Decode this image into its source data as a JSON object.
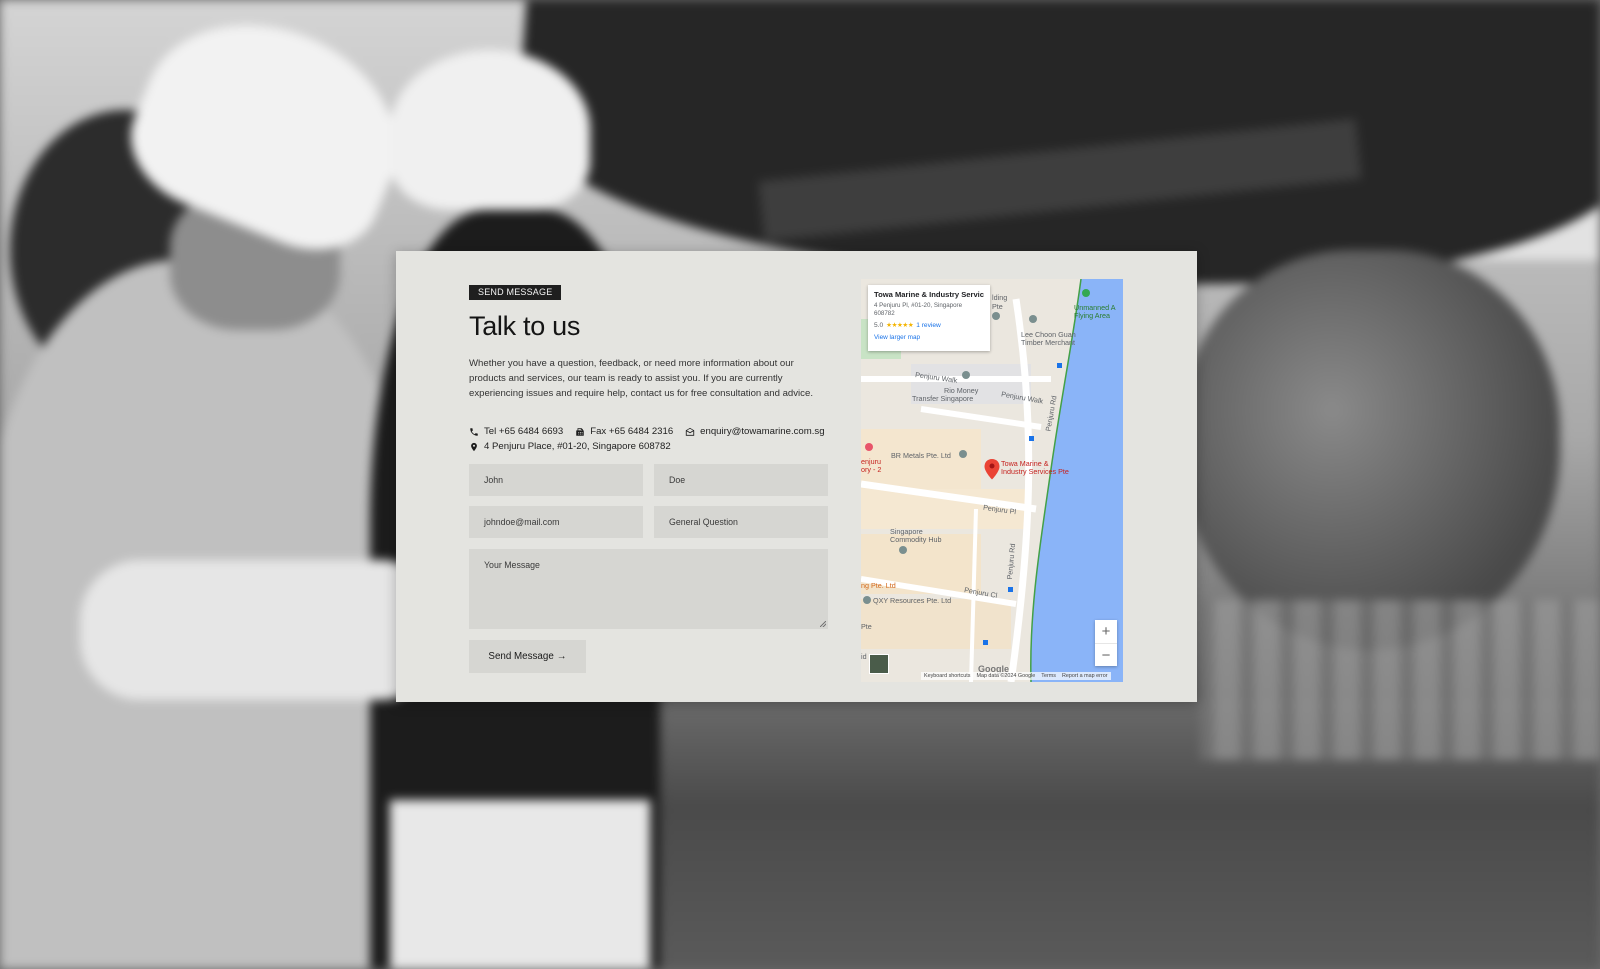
{
  "section": {
    "badge": "SEND MESSAGE",
    "title": "Talk to us",
    "description": "Whether you have a question, feedback, or need more information about our products and services, our team is ready to assist you. If you are currently experiencing issues and require help, contact us for free consultation and advice."
  },
  "contact": {
    "tel": "Tel +65 6484 6693",
    "fax": "Fax +65 6484 2316",
    "email": "enquiry@towamarine.com.sg",
    "address": "4 Penjuru Place, #01-20, Singapore 608782"
  },
  "form": {
    "first_name_placeholder": "John",
    "last_name_placeholder": "Doe",
    "email_placeholder": "johndoe@mail.com",
    "subject_placeholder": "General Question",
    "message_placeholder": "Your Message",
    "submit_label": "Send Message",
    "submit_arrow": "→"
  },
  "map": {
    "info_title": "Towa Marine & Industry Servic...",
    "info_address": "4 Penjuru Pl, #01-20, Singapore 608782",
    "rating": "5.0",
    "stars": "★★★★★",
    "reviews": "1 review",
    "larger_map": "View larger map",
    "labels": {
      "building": "lding",
      "building2": "Pte",
      "unmanned": "Unmanned A",
      "flying": "Flying Area",
      "lee_choon": "Lee Choon Guan",
      "timber": "Timber Merchant",
      "penjuru_walk_1": "Penjuru Walk",
      "rio_money": "Rio Money",
      "transfer": "Transfer Singapore",
      "penjuru_walk_2": "Penjuru Walk",
      "penjuru_rd_1": "Penjuru Rd",
      "enjuru": "enjuru",
      "ory": "ory - 2",
      "br_metals": "BR Metals Pte. Ltd",
      "towa_1": "Towa Marine &",
      "towa_2": "Industry Services Pte",
      "penjuru_pl": "Penjuru Pl",
      "commodity_1": "Singapore",
      "commodity_2": "Commodity Hub",
      "penjuru_rd_2": "Penjuru Rd",
      "ng_pte": "ng Pte. Ltd",
      "penjuru_cl": "Penjuru Cl",
      "qxy": "QXY Resources Pte. Ltd",
      "pte_small": "Pte",
      "id": "id"
    },
    "zoom_in": "+",
    "zoom_out": "−",
    "google": "Google",
    "keyboard": "Keyboard shortcuts",
    "map_data": "Map data ©2024 Google",
    "terms": "Terms",
    "report": "Report a map error"
  }
}
